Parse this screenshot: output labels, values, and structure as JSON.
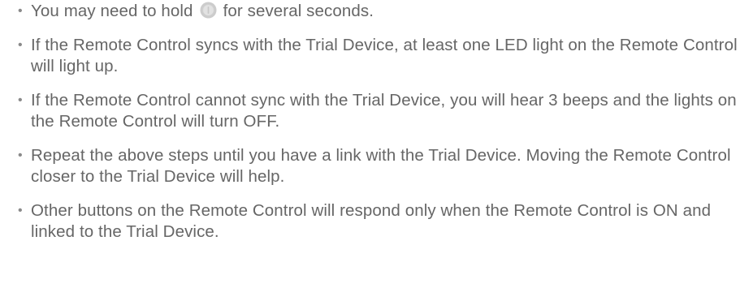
{
  "bullet_symbol": "•",
  "items": [
    {
      "before_icon": "You may need to hold",
      "icon": "power-button-icon",
      "after_icon": "for several seconds."
    },
    {
      "text": "If the Remote Control syncs with the Trial Device, at least one LED light on the Remote Control will light up."
    },
    {
      "text": "If the Remote Control cannot sync with the Trial Device, you will hear 3 beeps and the lights on the Remote Control will turn OFF."
    },
    {
      "text": "Repeat the above steps until you have a link with the Trial Device. Moving the Remote Control closer to the Trial Device will help."
    },
    {
      "text": "Other buttons on the Remote Control will respond only when the Remote Control is ON and linked to the Trial Device."
    }
  ],
  "colors": {
    "text": "#666666",
    "icon_outer": "#cccccc",
    "icon_inner": "#dedede"
  }
}
